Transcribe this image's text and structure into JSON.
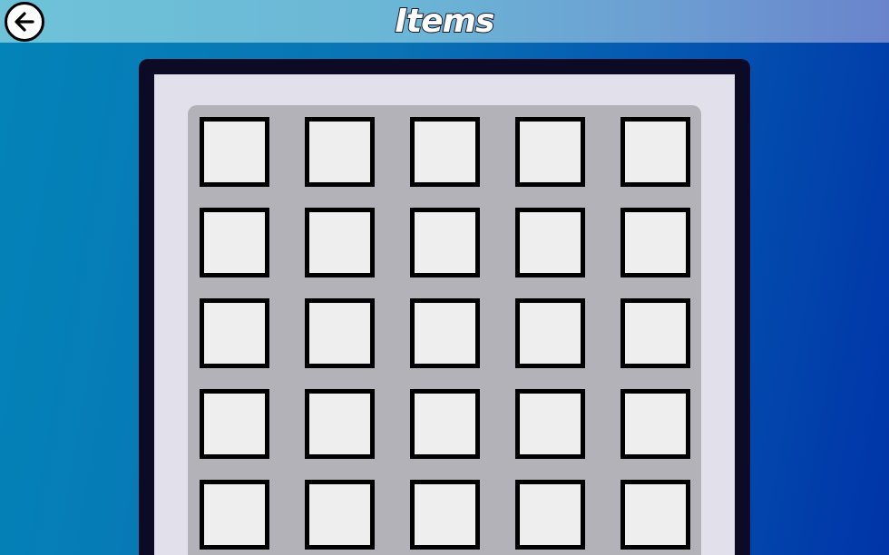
{
  "header": {
    "title": "Items",
    "back_icon": "arrow-left-icon"
  },
  "inventory": {
    "columns": 5,
    "visible_rows": 5,
    "slots": [
      {
        "item": null
      },
      {
        "item": null
      },
      {
        "item": null
      },
      {
        "item": null
      },
      {
        "item": null
      },
      {
        "item": null
      },
      {
        "item": null
      },
      {
        "item": null
      },
      {
        "item": null
      },
      {
        "item": null
      },
      {
        "item": null
      },
      {
        "item": null
      },
      {
        "item": null
      },
      {
        "item": null
      },
      {
        "item": null
      },
      {
        "item": null
      },
      {
        "item": null
      },
      {
        "item": null
      },
      {
        "item": null
      },
      {
        "item": null
      },
      {
        "item": null
      },
      {
        "item": null
      },
      {
        "item": null
      },
      {
        "item": null
      },
      {
        "item": null
      }
    ]
  },
  "colors": {
    "background_left": "#0384b8",
    "background_right": "#0034a8",
    "header_bar": "#6bb6d6",
    "frame": "#0c0a24",
    "panel": "#e2e0ea",
    "grid_background": "#b3b2b8",
    "slot_fill": "#eeeeee",
    "slot_border": "#000000"
  }
}
